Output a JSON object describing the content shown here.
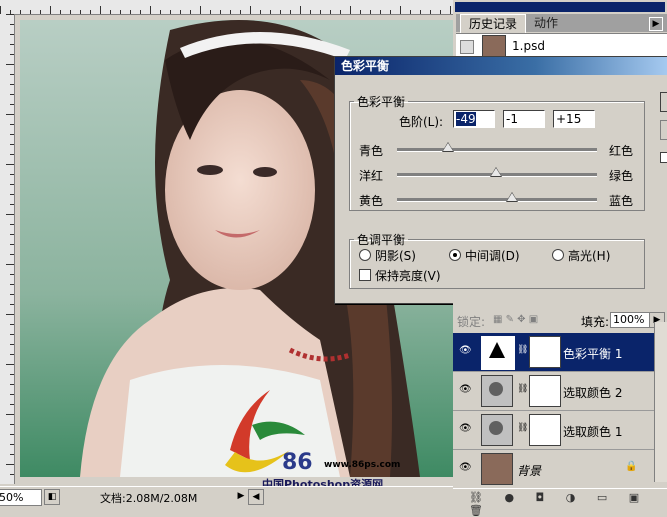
{
  "history_panel": {
    "tabs": [
      "历史记录",
      "动作"
    ],
    "snapshot_name": "1.psd"
  },
  "status_bar": {
    "zoom": "50%",
    "doc_size": "文档:2.08M/2.08M"
  },
  "watermark": {
    "logo_text": "86",
    "url": "www.86ps.com",
    "caption": "中国Photoshop资源网"
  },
  "dialog": {
    "title": "色彩平衡",
    "balance_group": {
      "legend": "色彩平衡",
      "levels_label": "色阶(L):",
      "levels": [
        "-49",
        "-1",
        "+15"
      ],
      "rows": [
        {
          "left": "青色",
          "right": "红色",
          "value": -49
        },
        {
          "left": "洋红",
          "right": "绿色",
          "value": -1
        },
        {
          "left": "黄色",
          "right": "蓝色",
          "value": 15
        }
      ]
    },
    "tone_group": {
      "legend": "色调平衡",
      "options": [
        "阴影(S)",
        "中间调(D)",
        "高光(H)"
      ],
      "selected": "中间调(D)",
      "preserve_label": "保持亮度(V)",
      "preserve_checked": false
    }
  },
  "layers_panel": {
    "lock_label": "锁定:",
    "fill_label": "填充:",
    "fill_value": "100%",
    "layers": [
      {
        "name": "色彩平衡 1",
        "active": true
      },
      {
        "name": "选取颜色 2",
        "active": false
      },
      {
        "name": "选取颜色 1",
        "active": false
      },
      {
        "name": "背景",
        "active": false
      }
    ]
  }
}
